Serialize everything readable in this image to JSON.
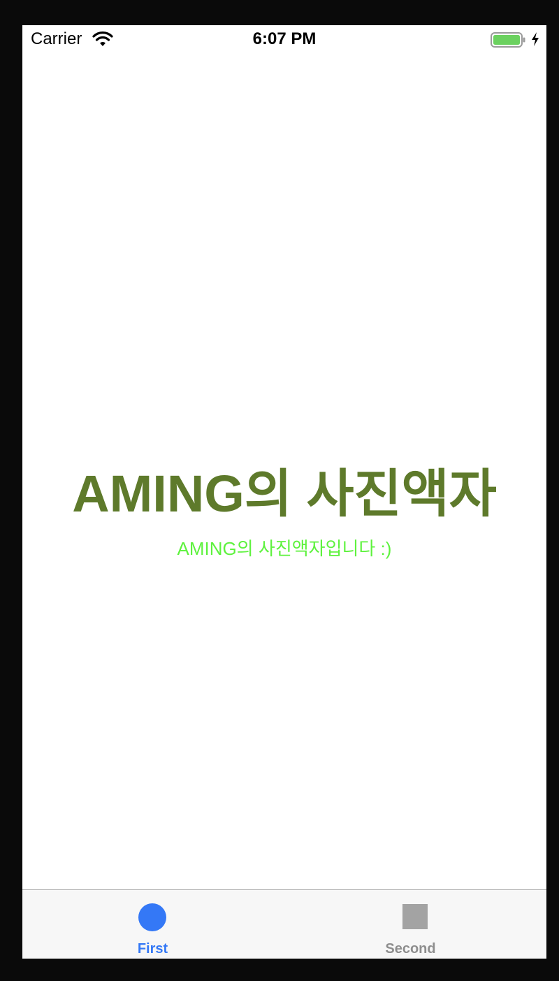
{
  "status_bar": {
    "carrier": "Carrier",
    "time": "6:07 PM",
    "battery_color": "#6bd15f",
    "wifi_icon": "wifi-icon",
    "battery_icon": "battery-icon",
    "charging_icon": "charging-bolt-icon"
  },
  "main": {
    "headline": "AMING의 사진액자",
    "subtitle": "AMING의 사진액자입니다 :)",
    "headline_color": "#5e7a2b",
    "subtitle_color": "#5ef23e"
  },
  "tab_bar": {
    "tabs": [
      {
        "label": "First",
        "icon": "circle-icon",
        "selected": true,
        "color": "#3478f6"
      },
      {
        "label": "Second",
        "icon": "square-icon",
        "selected": false,
        "color": "#8e8e8e"
      }
    ]
  }
}
